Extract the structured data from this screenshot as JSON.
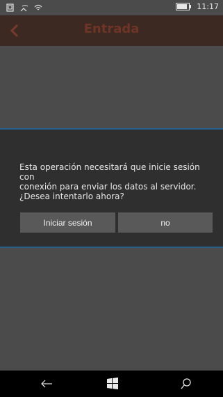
{
  "status": {
    "time": "11:17",
    "battery_level": 0.85
  },
  "header": {
    "title": "Entrada"
  },
  "dialog": {
    "message_lines": [
      "Esta operación necesitará que inicie sesión con",
      "conexión para enviar los datos al servidor.",
      "¿Desea intentarlo ahora?"
    ],
    "primary_button": "Iniciar sesión",
    "secondary_button": "no"
  },
  "colors": {
    "header_bg": "#3b2922",
    "header_text": "#6e3526",
    "dialog_bg": "#2f2f2f",
    "dialog_border": "#27608d",
    "content_bg": "#4b4b4b",
    "button_bg": "#595959",
    "navbar_bg": "#000000"
  },
  "icons": {
    "status_left": [
      "tablet-icon",
      "signal-icon",
      "wifi-icon"
    ],
    "status_right": [
      "battery-icon"
    ],
    "header": [
      "back-arrow-icon"
    ],
    "navbar": [
      "back-icon",
      "windows-icon",
      "search-icon"
    ]
  }
}
